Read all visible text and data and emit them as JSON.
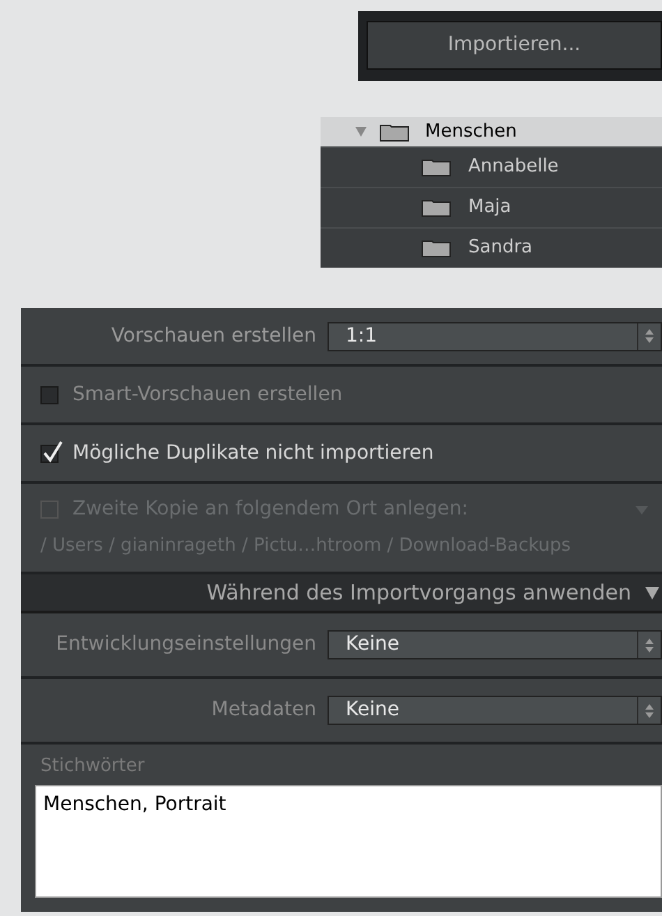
{
  "import_button": {
    "label": "Importieren..."
  },
  "folders": {
    "parent": {
      "name": "Menschen",
      "expanded": true
    },
    "children": [
      {
        "name": "Annabelle"
      },
      {
        "name": "Maja"
      },
      {
        "name": "Sandra"
      }
    ]
  },
  "options": [
    {
      "kind": "select",
      "label": "Vorschauen erstellen",
      "value": "1:1"
    },
    {
      "kind": "checkbox",
      "label": "Smart-Vorschauen erstellen",
      "checked": false,
      "disabled": false
    },
    {
      "kind": "checkbox",
      "label": "Mögliche Duplikate nicht importieren",
      "checked": true,
      "disabled": false
    },
    {
      "kind": "checkbox",
      "label": "Zweite Kopie an folgendem Ort anlegen:",
      "checked": false,
      "disabled": true,
      "path": "/ Users / gianinrageth / Pictu…htroom / Download-Backups"
    }
  ],
  "section": {
    "title": "Während des Importvorgangs anwenden",
    "expanded": true,
    "selects": [
      {
        "label": "Entwicklungseinstellungen",
        "value": "Keine"
      },
      {
        "label": "Metadaten",
        "value": "Keine"
      }
    ],
    "keywords": {
      "label": "Stichwörter",
      "value": "Menschen, Portrait"
    }
  }
}
